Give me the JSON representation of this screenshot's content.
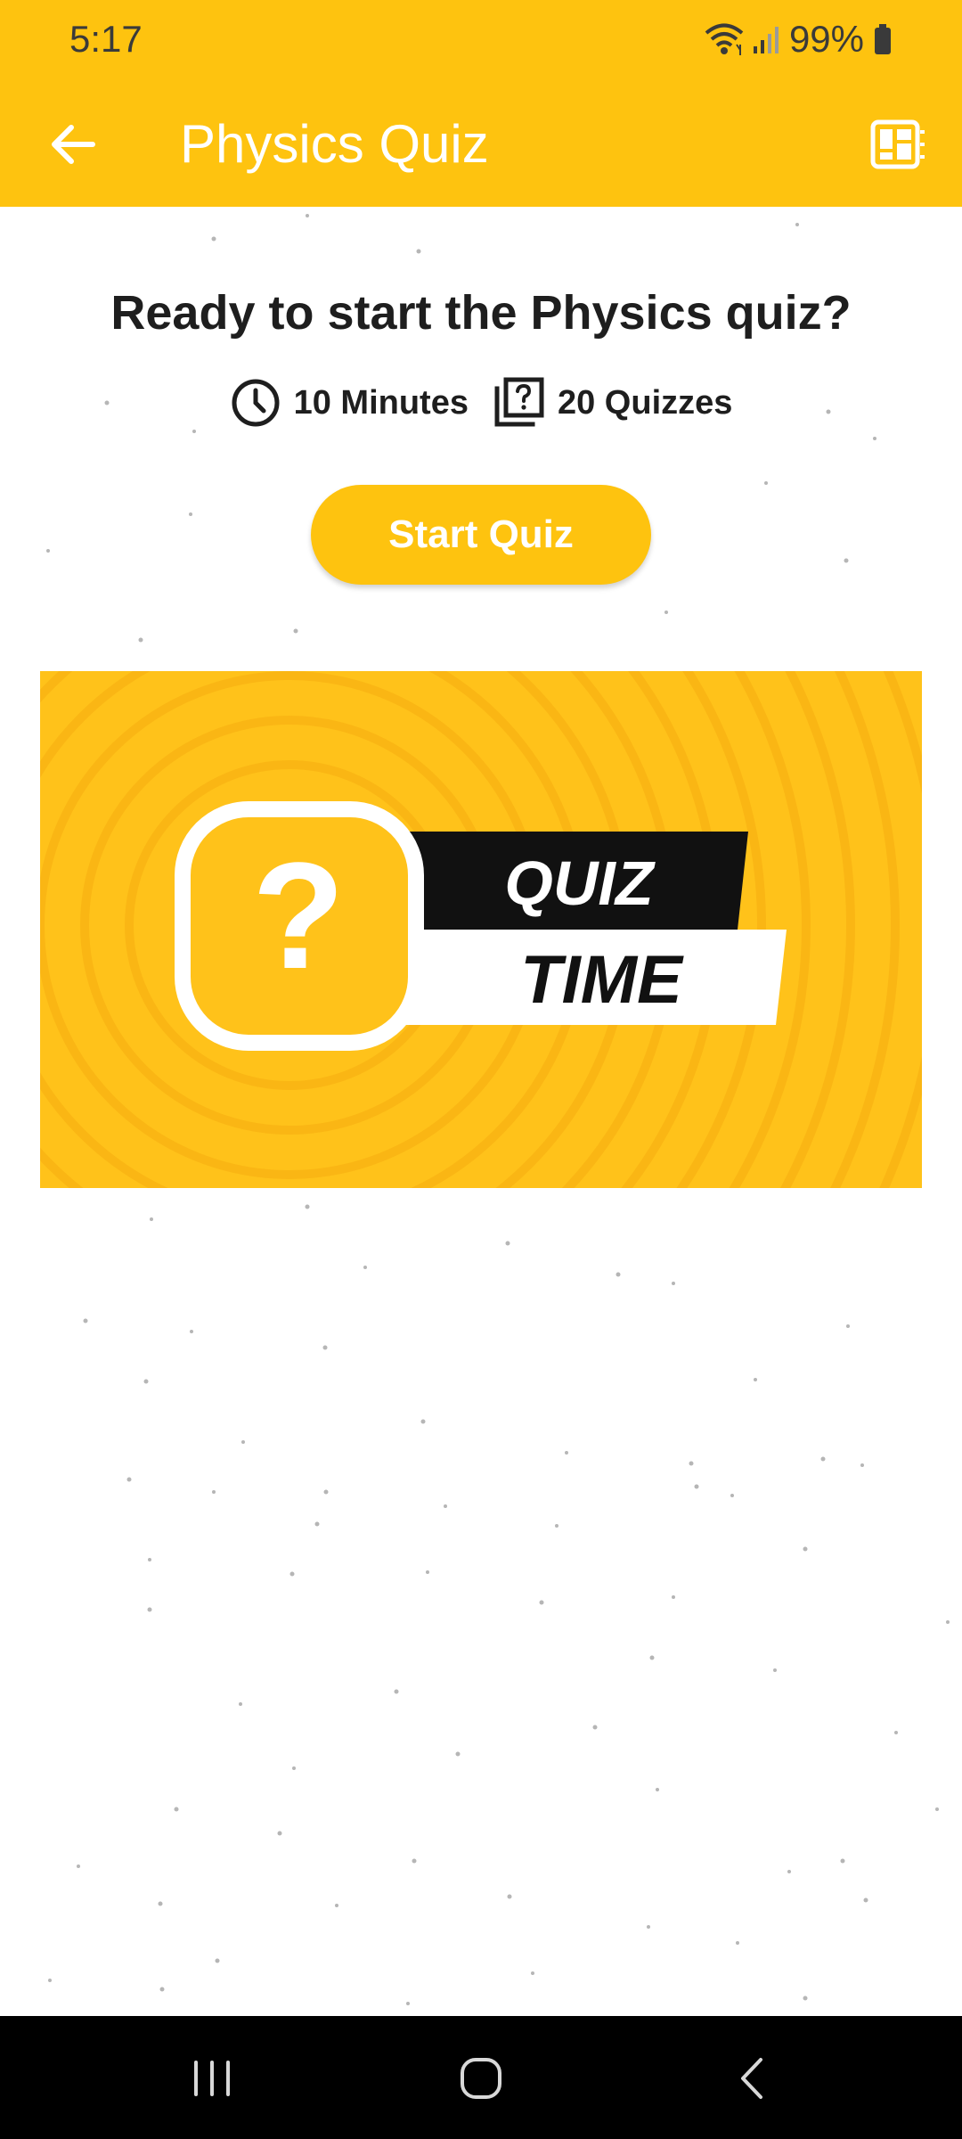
{
  "status_bar": {
    "time": "5:17",
    "battery": "99%",
    "icons": [
      "wifi-icon",
      "signal-icon",
      "battery-icon"
    ]
  },
  "app_bar": {
    "title": "Physics Quiz",
    "back_icon": "arrow-left-icon",
    "menu_icon": "dashboard-icon",
    "color": "#FEC30F"
  },
  "intro": {
    "heading": "Ready to start the Physics quiz?",
    "duration": "10 Minutes",
    "question_count": "20 Quizzes",
    "start_label": "Start Quiz"
  },
  "banner": {
    "line1": "QUIZ",
    "line2": "TIME",
    "symbol": "?",
    "background": "#FFC21A"
  },
  "nav_bar": {
    "icons": [
      "recent-apps-icon",
      "home-icon",
      "back-icon"
    ]
  }
}
